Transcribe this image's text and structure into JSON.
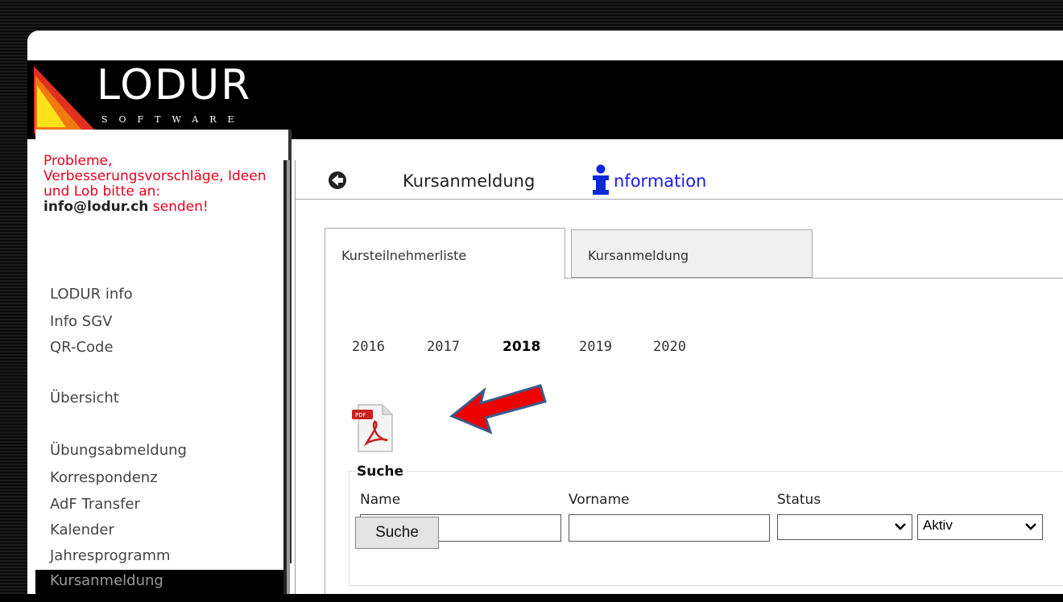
{
  "brand": {
    "name": "LODUR",
    "subtitle": "SOFTWARE"
  },
  "sidebar": {
    "notice_text": "Probleme, Verbesserungsvorschläge, Ideen und Lob bitte an:",
    "notice_email": "info@lodur.ch",
    "notice_suffix": " senden!",
    "items": [
      {
        "label": "LODUR info"
      },
      {
        "label": "Info SGV"
      },
      {
        "label": "QR-Code"
      },
      {
        "label": "Übersicht"
      },
      {
        "label": "Übungsabmeldung"
      },
      {
        "label": "Korrespondenz"
      },
      {
        "label": "AdF Transfer"
      },
      {
        "label": "Kalender"
      },
      {
        "label": "Jahresprogramm"
      },
      {
        "label": "Kursanmeldung"
      }
    ]
  },
  "header": {
    "title": "Kursanmeldung",
    "info_label": "nformation"
  },
  "tabs": [
    {
      "label": "Kursteilnehmerliste",
      "active": true
    },
    {
      "label": "Kursanmeldung",
      "active": false
    }
  ],
  "years": [
    "2016",
    "2017",
    "2018",
    "2019",
    "2020"
  ],
  "selected_year": "2018",
  "search": {
    "legend": "Suche",
    "name_label": "Name",
    "vorname_label": "Vorname",
    "status_label": "Status",
    "name_value": "",
    "vorname_value": "",
    "status_value": "",
    "active_filter_value": "Aktiv",
    "button_label": "Suche"
  },
  "colors": {
    "notice": "#e8001c",
    "info_link": "#1a1af0",
    "annotation_arrow": "#ee0000"
  }
}
